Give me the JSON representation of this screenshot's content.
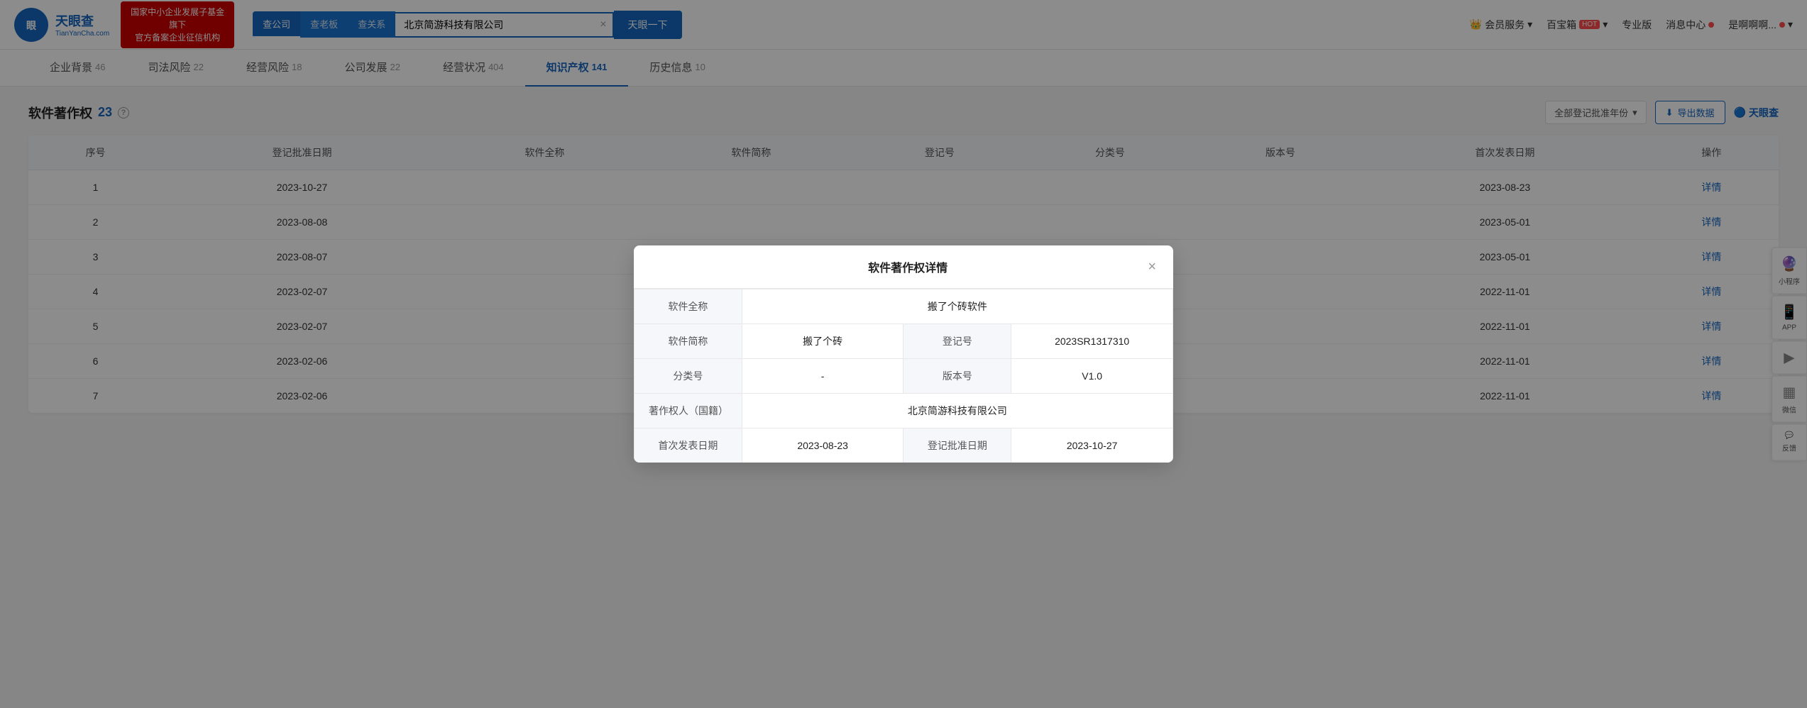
{
  "header": {
    "logo_main": "天眼查",
    "logo_sub": "TianYanCha.com",
    "promo_line1": "国家中小企业发展子基金旗下",
    "promo_line2": "官方备案企业征信机构",
    "search_tabs": [
      "查公司",
      "查老板",
      "查关系"
    ],
    "search_value": "北京简游科技有限公司",
    "search_btn": "天眼一下",
    "nav_items": [
      "会员服务",
      "百宝箱",
      "专业版",
      "消息中心",
      "是啊啊啊..."
    ],
    "hot_label": "HOT"
  },
  "sub_nav": {
    "items": [
      {
        "label": "企业背景",
        "badge": "46",
        "active": false
      },
      {
        "label": "司法风险",
        "badge": "22",
        "active": false
      },
      {
        "label": "经营风险",
        "badge": "18",
        "active": false
      },
      {
        "label": "公司发展",
        "badge": "22",
        "active": false
      },
      {
        "label": "经营状况",
        "badge": "404",
        "active": false
      },
      {
        "label": "知识产权",
        "badge": "141",
        "active": true
      },
      {
        "label": "历史信息",
        "badge": "10",
        "active": false
      }
    ]
  },
  "section": {
    "title": "软件著作权",
    "count": "23",
    "year_filter": "全部登记批准年份",
    "export_btn": "导出数据",
    "logo_brand": "天眼查"
  },
  "table": {
    "columns": [
      "序号",
      "登记批准日期",
      "软件全称",
      "软件简称",
      "登记号",
      "分类号",
      "版本号",
      "首次发表日期",
      "操作"
    ],
    "rows": [
      {
        "index": "1",
        "reg_date": "2023-10-27",
        "full_name": "",
        "short_name": "",
        "reg_no": "",
        "category": "",
        "version": "",
        "pub_date": "2023-08-23",
        "action": "详情"
      },
      {
        "index": "2",
        "reg_date": "2023-08-08",
        "full_name": "",
        "short_name": "",
        "reg_no": "",
        "category": "",
        "version": "",
        "pub_date": "2023-05-01",
        "action": "详情"
      },
      {
        "index": "3",
        "reg_date": "2023-08-07",
        "full_name": "",
        "short_name": "",
        "reg_no": "",
        "category": "",
        "version": "",
        "pub_date": "2023-05-01",
        "action": "详情"
      },
      {
        "index": "4",
        "reg_date": "2023-02-07",
        "full_name": "",
        "short_name": "",
        "reg_no": "",
        "category": "",
        "version": "",
        "pub_date": "2022-11-01",
        "action": "详情"
      },
      {
        "index": "5",
        "reg_date": "2023-02-07",
        "full_name": "",
        "short_name": "",
        "reg_no": "",
        "category": "",
        "version": "",
        "pub_date": "2022-11-01",
        "action": "详情"
      },
      {
        "index": "6",
        "reg_date": "2023-02-06",
        "full_name": "",
        "short_name": "",
        "reg_no": "",
        "category": "",
        "version": "",
        "pub_date": "2022-11-01",
        "action": "详情"
      },
      {
        "index": "7",
        "reg_date": "2023-02-06",
        "full_name": "",
        "short_name": "",
        "reg_no": "",
        "category": "",
        "version": "",
        "pub_date": "2022-11-01",
        "action": "详情"
      }
    ]
  },
  "modal": {
    "title": "软件著作权详情",
    "close_btn": "×",
    "fields": [
      {
        "label": "软件全称",
        "value": "搬了个砖软件",
        "span": "full"
      },
      {
        "label": "软件简称",
        "value": "搬了个砖",
        "label2": "登记号",
        "value2": "2023SR1317310",
        "span": "half"
      },
      {
        "label": "分类号",
        "value": "-",
        "label2": "版本号",
        "value2": "V1.0",
        "span": "half"
      },
      {
        "label": "著作权人（国籍）",
        "value": "北京简游科技有限公司",
        "span": "full"
      },
      {
        "label": "首次发表日期",
        "value": "2023-08-23",
        "label2": "登记批准日期",
        "value2": "2023-10-27",
        "span": "half"
      }
    ]
  },
  "float_tools": [
    {
      "icon": "♪",
      "label": "小程序"
    },
    {
      "icon": "📱",
      "label": "APP"
    },
    {
      "icon": "▶",
      "label": ""
    },
    {
      "icon": "▦",
      "label": "微信"
    },
    {
      "icon": "💬",
      "label": "反馈"
    }
  ]
}
